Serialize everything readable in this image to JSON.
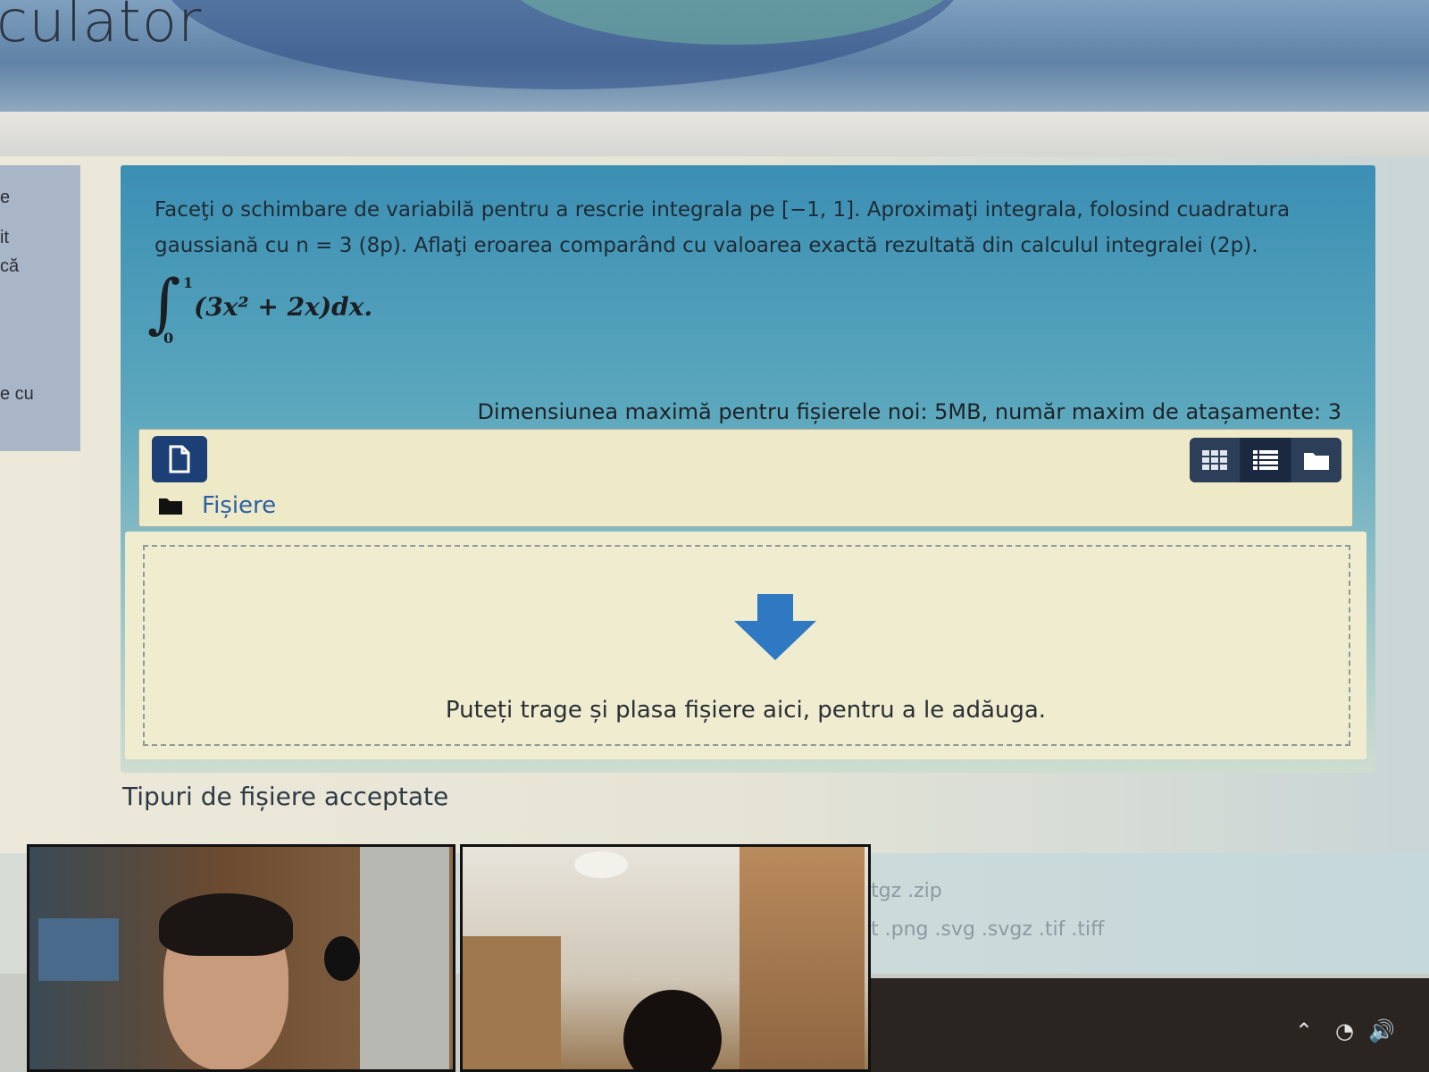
{
  "window": {
    "title": "culator"
  },
  "sidebar": {
    "fragments": [
      "e",
      "it",
      "că",
      "e cu"
    ]
  },
  "question": {
    "text_line1": "Faceţi o schimbare de variabilă pentru a rescrie integrala pe [−1, 1]. Aproximaţi integrala, folosind cuadratura",
    "text_line2": "gaussiană cu n = 3 (8p). Aflaţi eroarea comparând cu valoarea exactă rezultată din calculul integralei (2p).",
    "integral": {
      "upper": "1",
      "lower": "0",
      "expression": "(3x² + 2x)dx."
    }
  },
  "filemanager": {
    "max_size_text": "Dimensiunea maximă pentru fișierele noi: 5MB, număr maxim de atașamente: 3",
    "folder_label": "Fișiere",
    "add_file_icon": "file-icon",
    "view_icons": [
      "grid-icon",
      "list-icon",
      "folder-icon"
    ],
    "drop_hint": "Puteți trage și plasa fișiere aici, pentru a le adăuga."
  },
  "accepted_types": {
    "label": "Tipuri de fișiere acceptate",
    "line1": "tgz .zip",
    "line2": "t .png .svg .svgz .tif .tiff"
  },
  "colors": {
    "question_bg": "#3b8fb4",
    "button_dark": "#1c3f75",
    "link": "#2b5fa5",
    "drop_arrow": "#2f78c2"
  }
}
